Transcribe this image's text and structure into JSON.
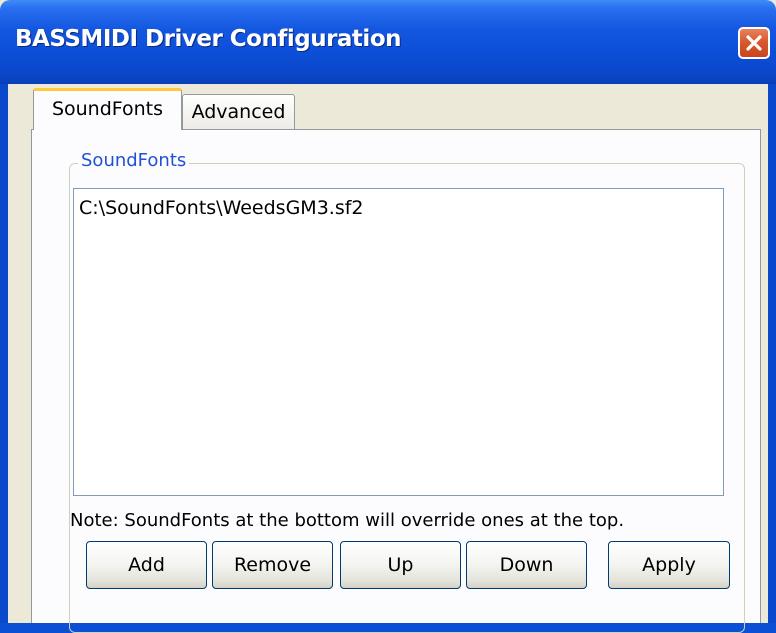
{
  "window": {
    "title": "BASSMIDI Driver Configuration"
  },
  "tabs": [
    {
      "label": "SoundFonts",
      "active": true
    },
    {
      "label": "Advanced",
      "active": false
    }
  ],
  "soundfonts_group": {
    "legend": "SoundFonts",
    "items": [
      "C:\\SoundFonts\\WeedsGM3.sf2"
    ],
    "note": "Note: SoundFonts at the bottom will override ones at the top."
  },
  "buttons": {
    "add": "Add",
    "remove": "Remove",
    "up": "Up",
    "down": "Down",
    "apply": "Apply"
  },
  "colors": {
    "titlebar": "#0a48cc",
    "close_button": "#d85a2f",
    "active_tab_accent": "#ffc83c",
    "group_legend": "#2150d6"
  }
}
